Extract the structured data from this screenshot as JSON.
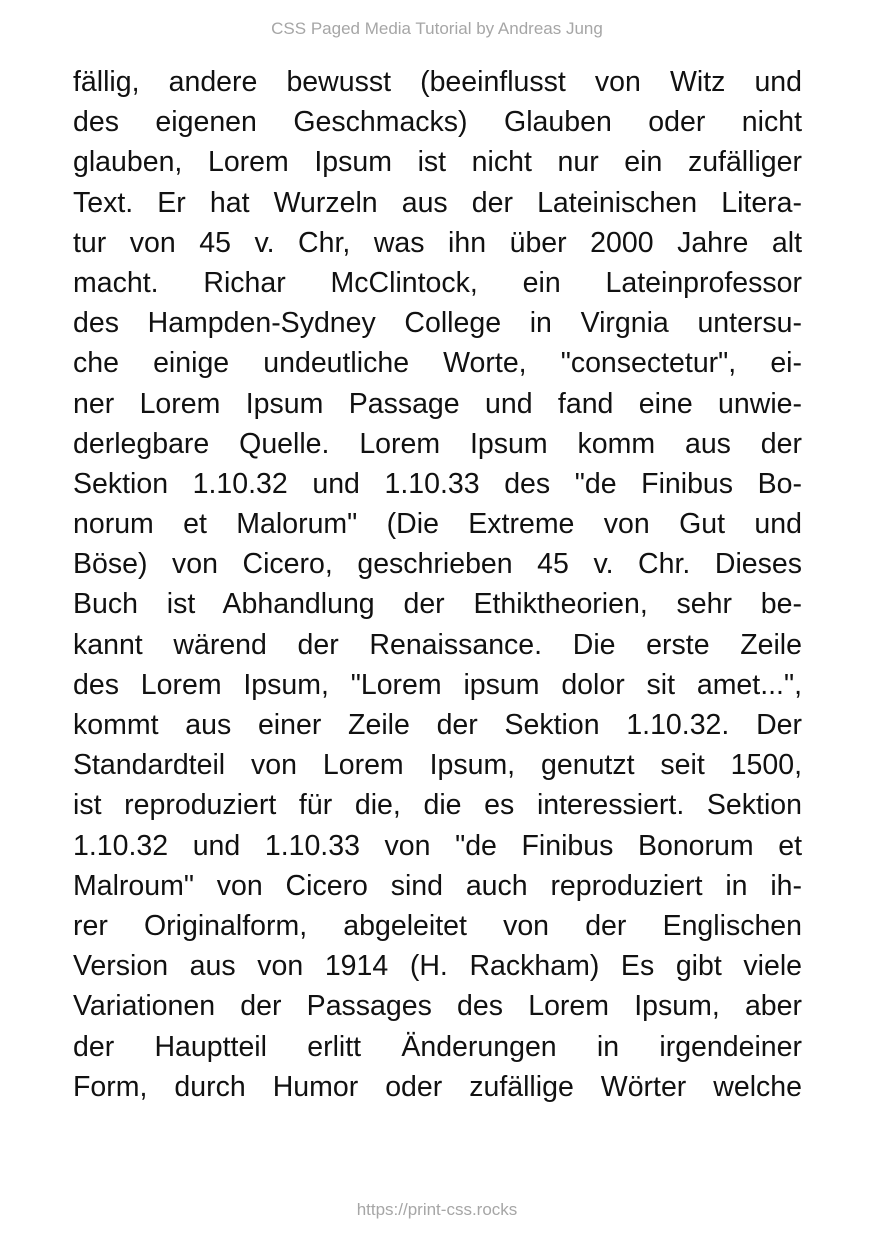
{
  "header": "CSS Paged Media Tutorial by Andreas Jung",
  "footer": "https://print-css.rocks",
  "lines": [
    "fällig, andere bewusst (beeinflusst von Witz und",
    "des eigenen Geschmacks) Glauben oder nicht",
    "glauben, Lorem Ipsum ist nicht nur ein zufälliger",
    "Text. Er hat Wurzeln aus der Lateinischen Litera-",
    "tur von 45 v. Chr, was ihn über 2000 Jahre alt",
    "macht. Richar McClintock, ein Lateinprofessor",
    "des Hampden-Sydney College in Virgnia untersu-",
    "che einige undeutliche Worte, \"consectetur\", ei-",
    "ner Lorem Ipsum Passage und fand eine unwie-",
    "derlegbare Quelle. Lorem Ipsum komm aus der",
    "Sektion 1.10.32 und 1.10.33 des \"de Finibus Bo-",
    "norum et Malorum\" (Die Extreme von Gut und",
    "Böse) von Cicero, geschrieben 45 v. Chr. Dieses",
    "Buch ist Abhandlung der Ethiktheorien, sehr be-",
    "kannt wärend der Renaissance. Die erste Zeile",
    "des Lorem Ipsum, \"Lorem ipsum dolor sit amet...\",",
    "kommt aus einer Zeile der Sektion 1.10.32. Der",
    "Standardteil von Lorem Ipsum, genutzt seit 1500,",
    "ist reproduziert für die, die es interessiert. Sektion",
    "1.10.32 und 1.10.33 von \"de Finibus Bonorum et",
    "Malroum\" von Cicero sind auch reproduziert in ih-",
    "rer Originalform, abgeleitet von der Englischen",
    "Version aus von 1914 (H. Rackham) Es gibt viele",
    "Variationen der Passages des Lorem Ipsum, aber",
    "der Hauptteil erlitt Änderungen in irgendeiner",
    "Form, durch Humor oder zufällige Wörter welche"
  ]
}
